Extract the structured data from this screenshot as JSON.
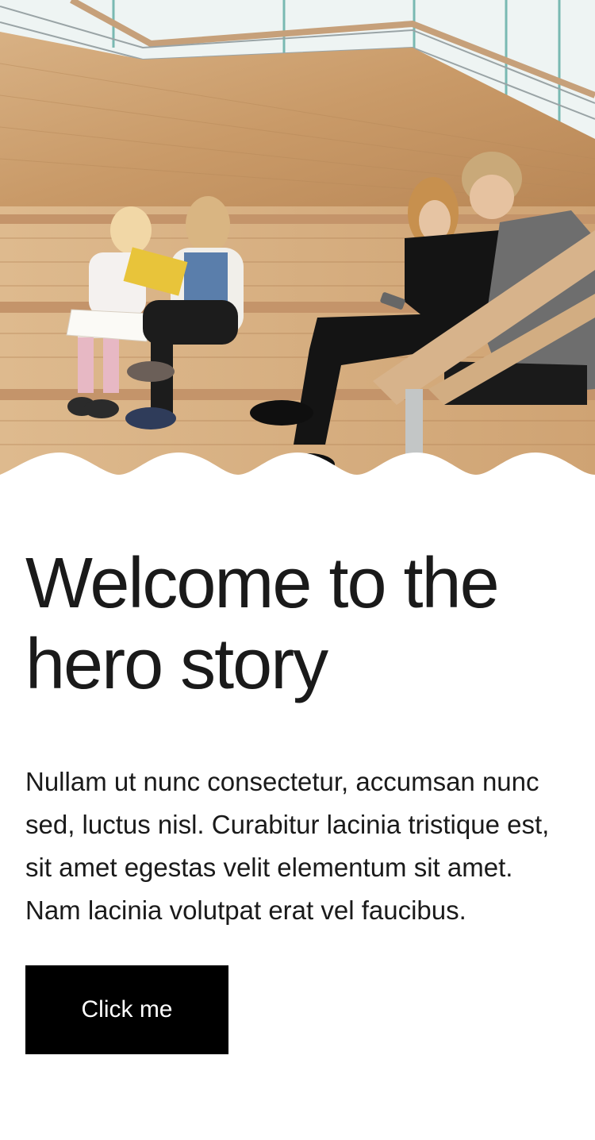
{
  "hero": {
    "image_name": "library-stairs-photo"
  },
  "heading": {
    "title": "Welcome to the hero story"
  },
  "body": {
    "text": "Nullam ut nunc consectetur, accumsan nunc sed, luctus nisl. Curabitur lacinia tristique est, sit amet egestas velit elementum sit amet. Nam lacinia volutpat erat vel faucibus."
  },
  "cta": {
    "label": "Click me"
  }
}
